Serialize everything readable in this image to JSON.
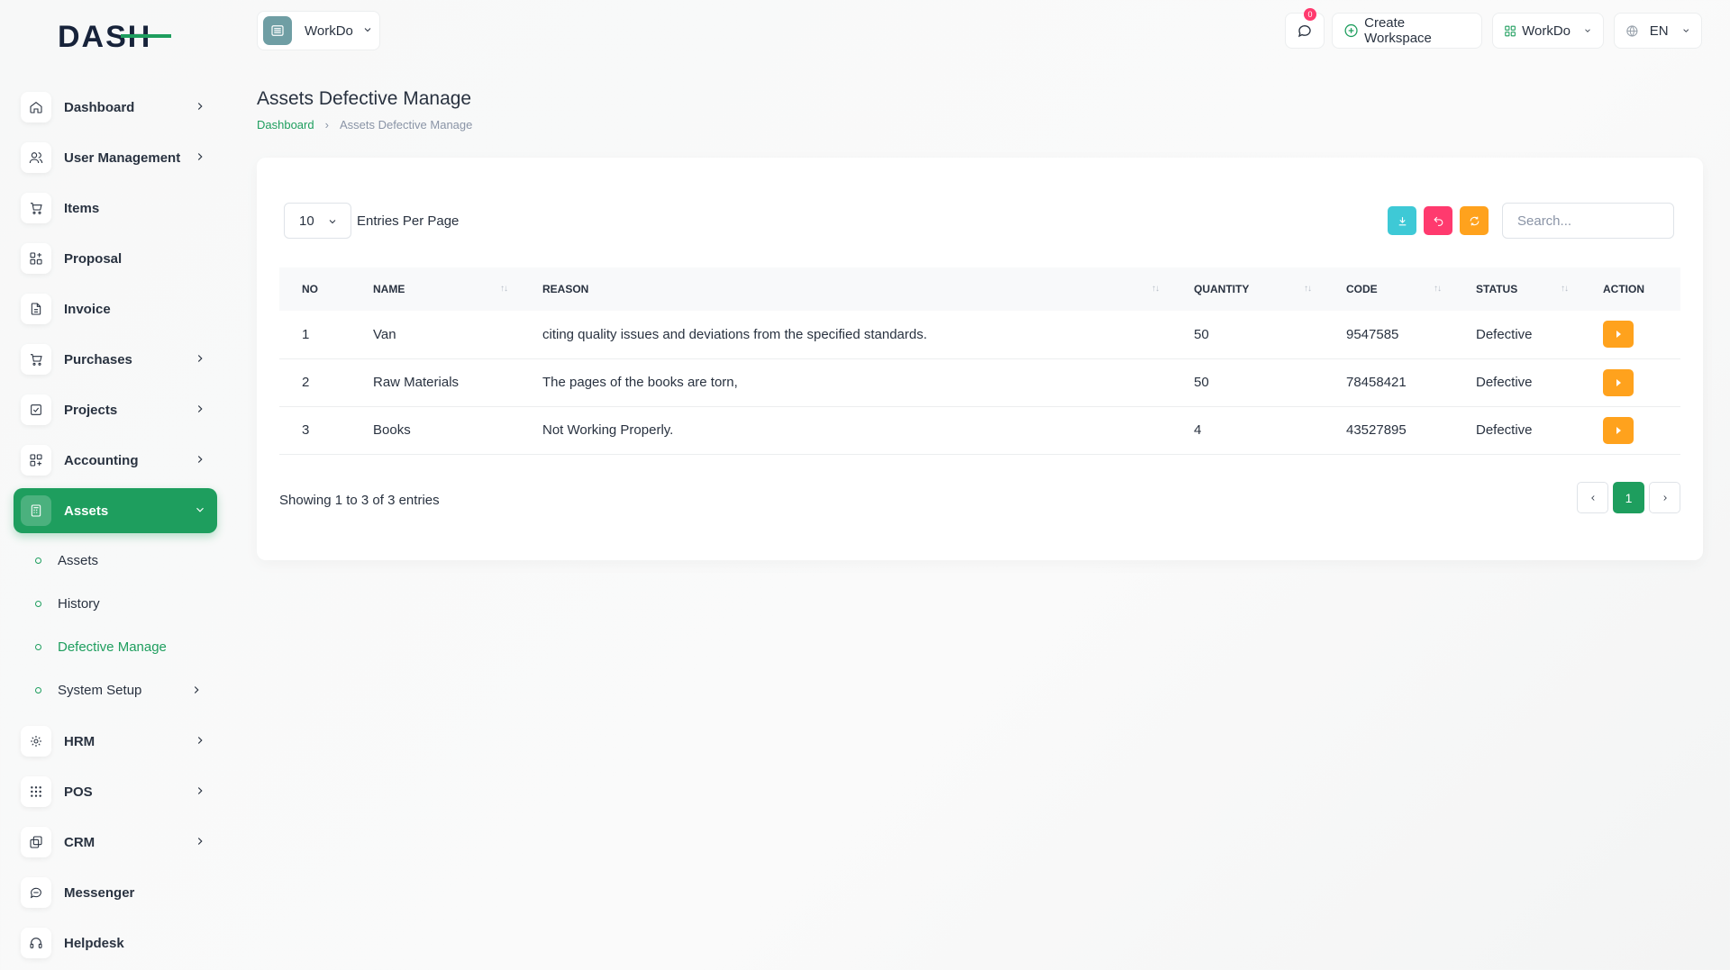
{
  "brand": {
    "logo_text": "DASH",
    "accent": "#1e9e5e"
  },
  "header": {
    "workspace": "WorkDo",
    "notification_count": "0",
    "create_workspace": "Create Workspace",
    "workdo_menu": "WorkDo",
    "language": "EN"
  },
  "sidebar": {
    "items": [
      {
        "label": "Dashboard",
        "icon": "home-icon"
      },
      {
        "label": "User Management",
        "icon": "users-icon"
      },
      {
        "label": "Items",
        "icon": "cart-icon"
      },
      {
        "label": "Proposal",
        "icon": "proposal-icon"
      },
      {
        "label": "Invoice",
        "icon": "file-icon"
      },
      {
        "label": "Purchases",
        "icon": "cart-icon"
      },
      {
        "label": "Projects",
        "icon": "check-square-icon"
      },
      {
        "label": "Accounting",
        "icon": "grid-icon"
      },
      {
        "label": "Assets",
        "icon": "calculator-icon"
      },
      {
        "label": "HRM",
        "icon": "hrm-icon"
      },
      {
        "label": "POS",
        "icon": "dots-grid-icon"
      },
      {
        "label": "CRM",
        "icon": "layers-icon"
      },
      {
        "label": "Messenger",
        "icon": "message-icon"
      },
      {
        "label": "Helpdesk",
        "icon": "headphones-icon"
      }
    ],
    "assets_sub": [
      {
        "label": "Assets"
      },
      {
        "label": "History"
      },
      {
        "label": "Defective Manage"
      },
      {
        "label": "System Setup"
      }
    ]
  },
  "page": {
    "title": "Assets Defective Manage",
    "breadcrumb_home": "Dashboard",
    "breadcrumb_current": "Assets Defective Manage"
  },
  "table": {
    "per_page": "10",
    "per_page_label": "Entries Per Page",
    "search_placeholder": "Search...",
    "columns": [
      "NO",
      "NAME",
      "REASON",
      "QUANTITY",
      "CODE",
      "STATUS",
      "ACTION"
    ],
    "rows": [
      {
        "no": "1",
        "name": "Van",
        "reason": "citing quality issues and deviations from the specified standards.",
        "quantity": "50",
        "code": "9547585",
        "status": "Defective"
      },
      {
        "no": "2",
        "name": "Raw Materials",
        "reason": "The pages of the books are torn,",
        "quantity": "50",
        "code": "78458421",
        "status": "Defective"
      },
      {
        "no": "3",
        "name": "Books",
        "reason": "Not Working Properly.",
        "quantity": "4",
        "code": "43527895",
        "status": "Defective"
      }
    ],
    "showing": "Showing 1 to 3 of 3 entries",
    "current_page": "1"
  }
}
